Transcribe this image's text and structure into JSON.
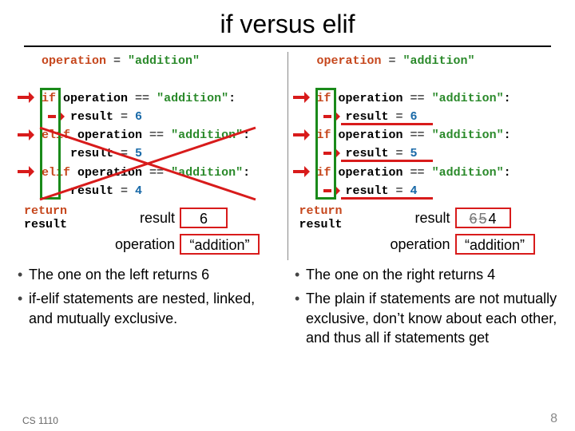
{
  "title": "if versus elif",
  "left": {
    "code": {
      "l1": {
        "kw": "operation",
        "rest": " = ",
        "str": "\"addition\""
      },
      "l2": {
        "kw": "if",
        "name": " operation ",
        "op": "== ",
        "str": "\"addition\"",
        "colon": ":"
      },
      "l3": {
        "name": "    result ",
        "op": "= ",
        "num": "6"
      },
      "l4": {
        "kw": "elif",
        "name": " operation ",
        "op": "== ",
        "str": "\"addition\"",
        "colon": ":"
      },
      "l5": {
        "name": "    result ",
        "op": "= ",
        "num": "5"
      },
      "l6": {
        "kw": "elif",
        "name": " operation ",
        "op": "== ",
        "str": "\"addition\"",
        "colon": ":"
      },
      "l7": {
        "name": "    result ",
        "op": "= ",
        "num": "4"
      },
      "ret": {
        "kw": "return",
        "name": " result"
      }
    },
    "result_label": "result",
    "result_value": "6",
    "operation_label": "operation",
    "operation_value": "“addition”",
    "bullets": [
      "The one on the left returns 6",
      "if-elif statements are nested, linked, and mutually exclusive."
    ]
  },
  "right": {
    "code": {
      "l1": {
        "kw": "operation",
        "rest": " = ",
        "str": "\"addition\""
      },
      "l2": {
        "kw": "if",
        "name": " operation ",
        "op": "== ",
        "str": "\"addition\"",
        "colon": ":"
      },
      "l3": {
        "name": "    result ",
        "op": "= ",
        "num": "6"
      },
      "l4": {
        "kw": "if",
        "name": " operation ",
        "op": "== ",
        "str": "\"addition\"",
        "colon": ":"
      },
      "l5": {
        "name": "    result ",
        "op": "= ",
        "num": "5"
      },
      "l6": {
        "kw": "if",
        "name": " operation ",
        "op": "== ",
        "str": "\"addition\"",
        "colon": ":"
      },
      "l7": {
        "name": "    result ",
        "op": "= ",
        "num": "4"
      },
      "ret": {
        "kw": "return",
        "name": " result"
      }
    },
    "result_label": "result",
    "result_struck1": "6",
    "result_struck2": "5",
    "result_value": "4",
    "operation_label": "operation",
    "operation_value": "“addition”",
    "bullets": [
      "The one on the right returns 4",
      "The plain if statements are not mutually exclusive, don’t know about each other, and thus all if statements get"
    ]
  },
  "footer_left": "CS 1110",
  "footer_right": "8"
}
